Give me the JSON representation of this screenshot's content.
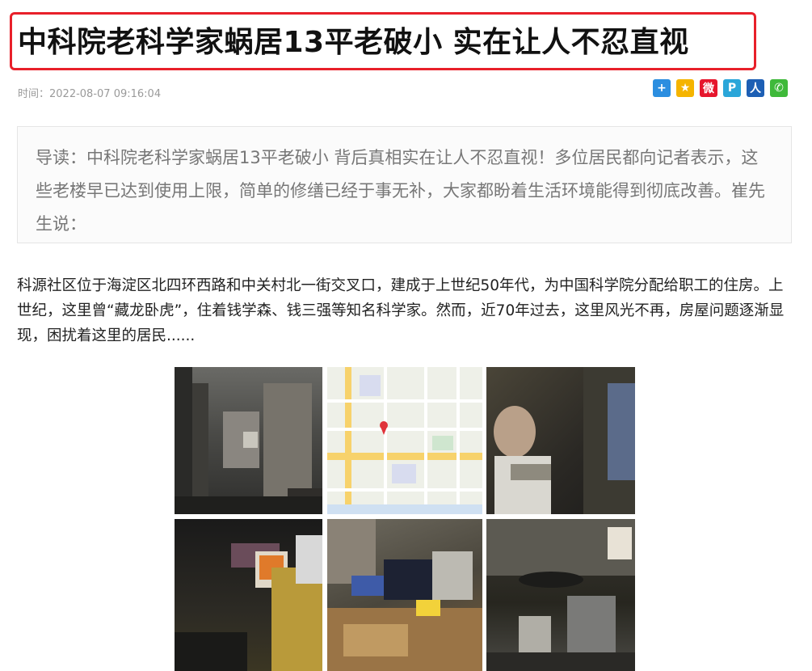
{
  "article": {
    "title": "中科院老科学家蜗居13平老破小 实在让人不忍直视",
    "time_label": "时间：",
    "time_value": "2022-08-07 09:16:04"
  },
  "share": [
    {
      "name": "add-share-icon",
      "glyph": "+",
      "color": "#2b8ee0"
    },
    {
      "name": "qzone-share-icon",
      "glyph": "★",
      "color": "#f5b400"
    },
    {
      "name": "weibo-share-icon",
      "glyph": "微",
      "color": "#e6162d"
    },
    {
      "name": "tencent-weibo-share-icon",
      "glyph": "P",
      "color": "#2aa6d9"
    },
    {
      "name": "renren-share-icon",
      "glyph": "人",
      "color": "#1d5fb4"
    },
    {
      "name": "wechat-share-icon",
      "glyph": "✆",
      "color": "#3fb93a"
    }
  ],
  "lead": {
    "text": "导读：中科院老科学家蜗居13平老破小 背后真相实在让人不忍直视！多位居民都向记者表示，这些老楼早已达到使用上限，简单的修缮已经于事无补，大家都盼着生活环境能得到彻底改善。崔先生说："
  },
  "body": {
    "paragraph": "科源社区位于海淀区北四环西路和中关村北一街交叉口，建成于上世纪50年代，为中国科学院分配给职工的住房。上世纪，这里曾“藏龙卧虎”，住着钱学森、钱三强等知名科学家。然而，近70年过去，这里风光不再，房屋问题逐渐显现，困扰着这里的居民......"
  }
}
